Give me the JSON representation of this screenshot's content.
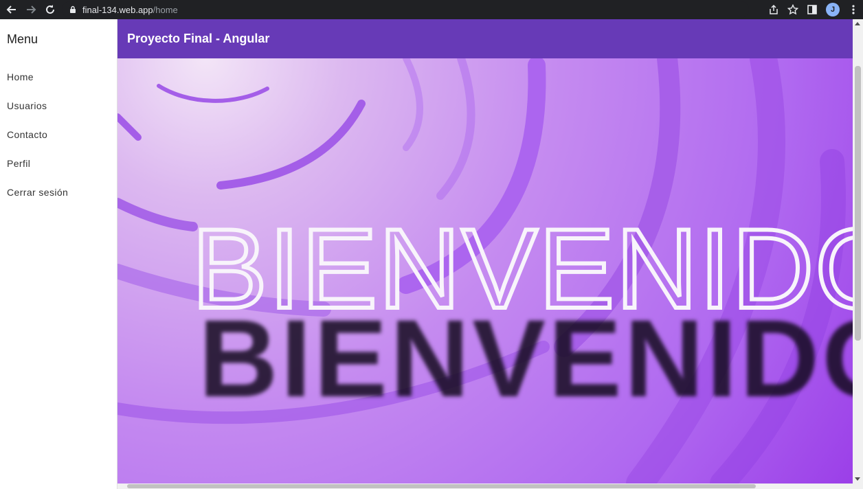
{
  "browser": {
    "url_host": "final-134.web.app",
    "url_path": "/home",
    "profile_initial": "J",
    "icons": [
      "back-arrow-icon",
      "forward-arrow-icon",
      "reload-icon",
      "lock-icon",
      "share-icon",
      "star-icon",
      "side-panel-icon",
      "more-vert-icon"
    ]
  },
  "sidebar": {
    "title": "Menu",
    "items": [
      {
        "label": "Home"
      },
      {
        "label": "Usuarios"
      },
      {
        "label": "Contacto"
      },
      {
        "label": "Perfil"
      },
      {
        "label": "Cerrar sesión"
      }
    ]
  },
  "toolbar": {
    "title": "Proyecto Final - Angular"
  },
  "hero": {
    "welcome_text": "BIENVENIDO"
  },
  "colors": {
    "chrome_bg": "#202124",
    "toolbar_bg": "#673ab7",
    "hero_purple": "#b069f0"
  }
}
